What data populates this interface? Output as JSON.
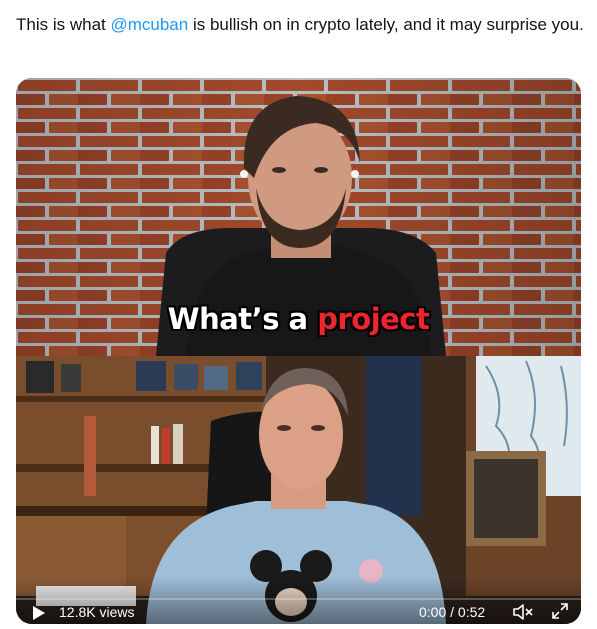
{
  "tweet": {
    "text_before": "This is what ",
    "mention": "@mcuban",
    "text_after": " is bullish on in crypto lately, and it may surprise you."
  },
  "video": {
    "caption_white": "What’s a ",
    "caption_red": "project",
    "views": "12.8K views",
    "time": "0:00 / 0:52",
    "progress": 0,
    "icons": {
      "play": "play-icon",
      "volume": "speaker-muted-icon",
      "fullscreen": "expand-icon"
    }
  },
  "colors": {
    "mention": "#1d9bf0",
    "caption_red": "#f0242a",
    "brick": "#a04a2e"
  }
}
